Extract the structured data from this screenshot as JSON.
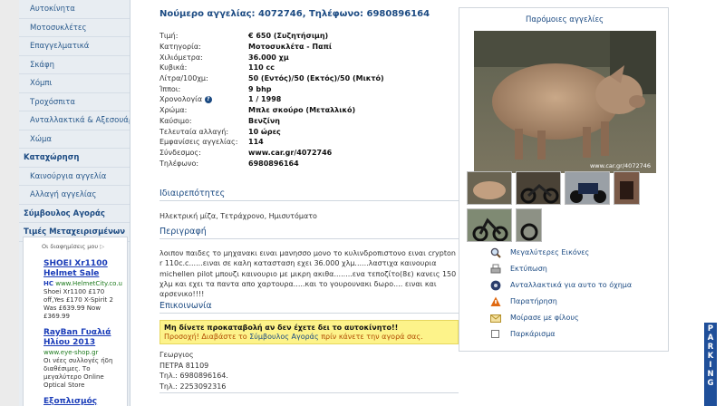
{
  "sidebar": {
    "items": [
      {
        "label": "Αυτοκίνητα",
        "kind": "item"
      },
      {
        "label": "Μοτοσυκλέτες",
        "kind": "item"
      },
      {
        "label": "Επαγγελματικά",
        "kind": "item"
      },
      {
        "label": "Σκάφη",
        "kind": "item"
      },
      {
        "label": "Χόμπι",
        "kind": "item"
      },
      {
        "label": "Τροχόσπιτα",
        "kind": "item"
      },
      {
        "label": "Ανταλλακτικά & Αξεσουάρ",
        "kind": "item"
      },
      {
        "label": "Χώμα",
        "kind": "item"
      },
      {
        "label": "Καταχώρηση",
        "kind": "head"
      },
      {
        "label": "Καινούργια αγγελία",
        "kind": "item"
      },
      {
        "label": "Αλλαγή αγγελίας",
        "kind": "item"
      },
      {
        "label": "Σύμβουλος Αγοράς",
        "kind": "head"
      },
      {
        "label": "Τιμές Μεταχειρισμένων",
        "kind": "head"
      }
    ]
  },
  "ads": {
    "ads_by": "Οι διαφημίσεις μου",
    "items": [
      {
        "title": "SHOEI Xr1100 Helmet Sale",
        "url": "www.HelmetCity.co.u",
        "badge": "HC",
        "text": "Shoei Xr1100 £170 off,Yes £170 X-Spirit 2 Was £639.99 Now £369.99"
      },
      {
        "title": "RayBan Γυαλιά Ηλίου 2013",
        "url": "www.eye-shop.gr",
        "badge": "",
        "text": "Οι νέες συλλογές ήδη διαθέσιμες. Το μεγαλύτερο Online Optical Store"
      },
      {
        "title": "Εξοπλισμός",
        "url": "",
        "badge": "",
        "text": ""
      }
    ]
  },
  "listing": {
    "header": "Νούμερο αγγελίας: 4072746, Τηλέφωνο: 6980896164",
    "specs": [
      {
        "label": "Τιμή:",
        "value": "€ 650 (Συζητήσιμη)"
      },
      {
        "label": "Κατηγορία:",
        "value": "Μοτοσυκλέτα - Παπί"
      },
      {
        "label": "Χιλιόμετρα:",
        "value": "36.000 χμ"
      },
      {
        "label": "Κυβικά:",
        "value": "110 cc"
      },
      {
        "label": "Λίτρα/100χμ:",
        "value": "50 (Εντός)/50 (Εκτός)/50 (Μικτό)"
      },
      {
        "label": "Ίπποι:",
        "value": "9 bhp"
      },
      {
        "label": "Χρονολογία",
        "value": "1 / 1998",
        "help": true
      },
      {
        "label": "Χρώμα:",
        "value": "Μπλε σκούρο (Μεταλλικό)"
      },
      {
        "label": "Καύσιμο:",
        "value": "Βενζίνη"
      },
      {
        "label": "Τελευταία αλλαγή:",
        "value": "10 ώρες"
      },
      {
        "label": "Εμφανίσεις αγγελίας:",
        "value": "114"
      },
      {
        "label": "Σύνδεσμος:",
        "value": "www.car.gr/4072746"
      },
      {
        "label": "Τηλέφωνο:",
        "value": "6980896164"
      }
    ],
    "features_title": "Ιδιαιρεπότητες",
    "features_text": "Ηλεκτρική μίζα, Τετράχρονο, Ημισυτόματο",
    "description_title": "Περιγραφή",
    "description_text": "λοιπον παιδες το μηχανακι ειναι μανησσο μονο το κυλινδροπιστονο ειναι crypton r 110c.c......ειναι σε καλη κατασταση εχει 36.000 χλμ......λαστιχα καινουρια michellen pilot μπουζι καινουριο με μικρη ακιθα........ενα τεποζίτο(8ε) κανεις 150 χλμ και εχει τα παντα απο χαρτουρα.....και το γουρουνακι δωρο.... ειναι και αρσενικο!!!!",
    "contact_title": "Επικοινωνία",
    "warning_bold": "Μη δίνετε προκαταβολή αν δεν έχετε δει το αυτοκίνητο!!",
    "warning_pre": "Προσοχή! Διαβάστε το ",
    "warning_link": "Σύμβουλος Αγοράς",
    "warning_post": " πρίν κάνετε την αγορά σας.",
    "contact_lines": [
      "Γεωργιος",
      "ΠΕΤΡΑ 81109",
      "Τηλ.: 6980896164.",
      "Τηλ.: 2253092316"
    ]
  },
  "similar": {
    "title": "Παρόμοιες αγγελίες",
    "watermark": "www.car.gr/4072746",
    "actions": [
      {
        "label": "Μεγαλύτερες Εικόνες",
        "icon": "magnifier-icon"
      },
      {
        "label": "Εκτύπωση",
        "icon": "printer-icon"
      },
      {
        "label": "Ανταλλακτικά για αυτο το όχημα",
        "icon": "wheel-icon"
      },
      {
        "label": "Παρατήρηση",
        "icon": "warning-cone-icon"
      },
      {
        "label": "Μοίρασε με φίλους",
        "icon": "envelope-icon"
      },
      {
        "label": "Παρκάρισμα",
        "icon": "checkbox-icon"
      }
    ]
  },
  "parking": {
    "letters": [
      "P",
      "A",
      "R",
      "K",
      "I",
      "N",
      "G"
    ]
  },
  "colors": {
    "link": "#1b4a82",
    "warning_bg": "#fdf38a",
    "parking": "#1f4f9a"
  }
}
